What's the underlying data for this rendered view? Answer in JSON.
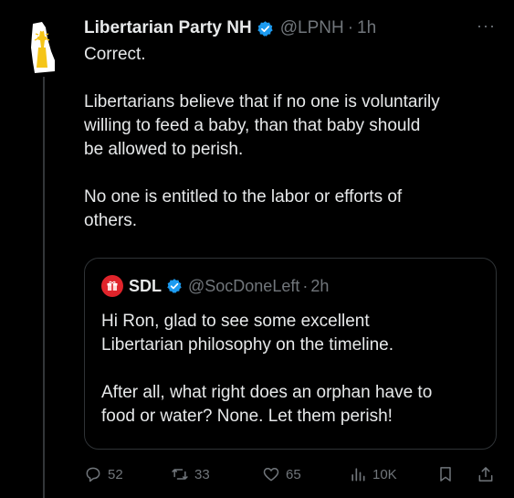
{
  "tweet": {
    "author_name": "Libertarian Party NH",
    "handle": "@LPNH",
    "separator": "·",
    "time": "1h",
    "more_label": "···",
    "paragraphs": [
      "Correct.",
      "Libertarians believe that if no one is voluntarily\nwilling to feed a baby, than that baby should\nbe allowed to perish.",
      "No one is entitled to the labor or efforts of\nothers."
    ]
  },
  "quote": {
    "author_name": "SDL",
    "handle": "@SocDoneLeft",
    "separator": "·",
    "time": "2h",
    "paragraphs": [
      "Hi Ron, glad to see some excellent\nLibertarian philosophy on the timeline.",
      "After all, what right does an orphan have to\nfood or water? None. Let them perish!"
    ]
  },
  "actions": {
    "replies": "52",
    "reposts": "33",
    "likes": "65",
    "views": "10K"
  },
  "icons": {
    "verified": "verified-badge-icon",
    "reply": "reply-icon",
    "repost": "repost-icon",
    "like": "heart-icon",
    "views": "analytics-icon",
    "bookmark": "bookmark-icon",
    "share": "share-icon"
  },
  "colors": {
    "background": "#000000",
    "text": "#e7e9ea",
    "muted": "#71767b",
    "verified": "#1d9bf0",
    "border": "#2f3336",
    "sdl_avatar": "#e0242b",
    "lpnh_logo": "#f5c518"
  }
}
